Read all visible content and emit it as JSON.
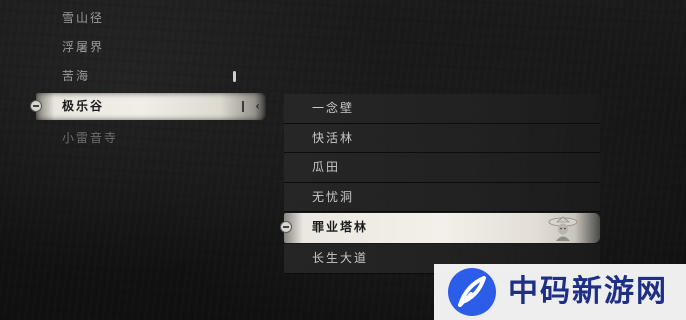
{
  "regions": [
    {
      "name": "雪山径",
      "state": "normal"
    },
    {
      "name": "浮屠界",
      "state": "normal"
    },
    {
      "name": "苦海",
      "state": "normal"
    },
    {
      "name": "极乐谷",
      "state": "selected"
    },
    {
      "name": "小雷音寺",
      "state": "dim"
    }
  ],
  "selected_region_arrow": "‹",
  "locations": [
    {
      "name": "一念壁",
      "state": "normal"
    },
    {
      "name": "快活林",
      "state": "normal"
    },
    {
      "name": "瓜田",
      "state": "normal"
    },
    {
      "name": "无忧洞",
      "state": "normal"
    },
    {
      "name": "罪业塔林",
      "state": "selected"
    },
    {
      "name": "长生大道",
      "state": "normal"
    }
  ],
  "icons": {
    "region_seal": "seal-icon",
    "scroll_indicator": "scroll-indicator-icon",
    "portrait": "character-portrait-icon",
    "watermark_logo": "feather-logo-icon"
  },
  "colors": {
    "background": "#151515",
    "selected_bar": "#f1eee8",
    "text_normal": "#c9c9c9",
    "text_selected": "#1a1a1a",
    "watermark_text": "#1e2f86",
    "watermark_logo": "#2b5de8"
  },
  "watermark": {
    "text": "中码新游网"
  }
}
